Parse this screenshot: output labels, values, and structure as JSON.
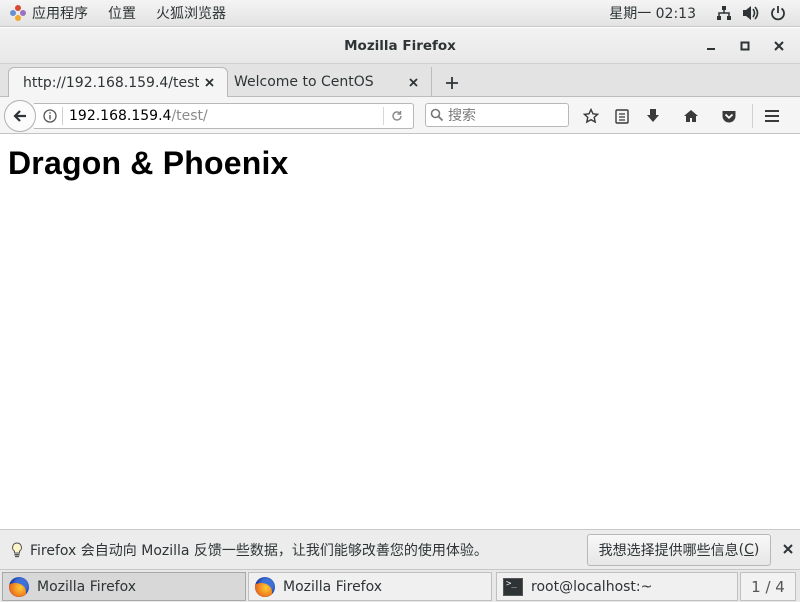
{
  "topbar": {
    "applications": "应用程序",
    "places": "位置",
    "active_app": "火狐浏览器",
    "clock": "星期一 02:13"
  },
  "window": {
    "title": "Mozilla Firefox"
  },
  "tabs": [
    {
      "label": "http://192.168.159.4/test/",
      "active": true
    },
    {
      "label": "Welcome to CentOS",
      "active": false
    }
  ],
  "urlbar": {
    "host": "192.168.159.4",
    "path": "/test/"
  },
  "search": {
    "placeholder": "搜索"
  },
  "page": {
    "heading": "Dragon & Phoenix"
  },
  "notification": {
    "message": "Firefox 会自动向 Mozilla 反馈一些数据，让我们能够改善您的使用体验。",
    "button_label": "我想选择提供哪些信息",
    "button_accesskey": "C"
  },
  "taskbar": {
    "tasks": [
      {
        "label": "Mozilla Firefox",
        "icon": "firefox-icon",
        "active": true
      },
      {
        "label": "Mozilla Firefox",
        "icon": "firefox-icon",
        "active": false
      },
      {
        "label": "root@localhost:~",
        "icon": "terminal-icon",
        "active": false
      }
    ],
    "workspace": "1 / 4"
  },
  "colors": {
    "topbar_bg": "#e8e8e8",
    "tab_active_bg": "#f5f5f5",
    "content_bg": "#ffffff",
    "notification_bg": "#ececec"
  }
}
